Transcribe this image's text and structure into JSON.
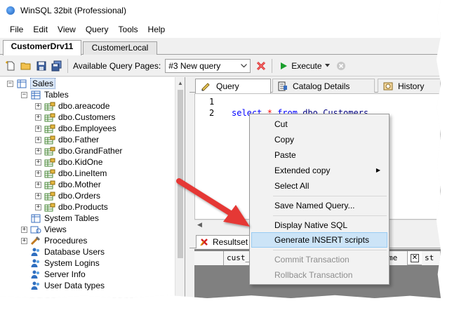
{
  "window": {
    "title": "WinSQL 32bit (Professional)"
  },
  "menu": [
    "File",
    "Edit",
    "View",
    "Query",
    "Tools",
    "Help"
  ],
  "connection_tabs": [
    "CustomerDrv11",
    "CustomerLocal"
  ],
  "toolbar": {
    "pages_label": "Available Query Pages:",
    "selected_page": "#3 New query",
    "execute_label": "Execute"
  },
  "tree": {
    "root": "Sales",
    "tables_label": "Tables",
    "tables": [
      "dbo.areacode",
      "dbo.Customers",
      "dbo.Employees",
      "dbo.Father",
      "dbo.GrandFather",
      "dbo.KidOne",
      "dbo.LineItem",
      "dbo.Mother",
      "dbo.Orders",
      "dbo.Products"
    ],
    "other_nodes": [
      "System Tables",
      "Views",
      "Procedures",
      "Database Users",
      "System Logins",
      "Server Info",
      "User Data types"
    ]
  },
  "query_tabs": [
    "Query",
    "Catalog Details",
    "History"
  ],
  "editor": {
    "line_numbers": [
      "1",
      "2"
    ],
    "tokens": {
      "kw1": "select",
      "op": "*",
      "kw2": "from",
      "table": "dbo.Customers"
    }
  },
  "results": {
    "tab_label": "Resultset #",
    "columns": [
      "cust_",
      "me",
      "st"
    ]
  },
  "context_menu": {
    "items": [
      "Cut",
      "Copy",
      "Paste",
      "Extended copy",
      "Select All",
      "Save Named Query...",
      "Display Native SQL",
      "Generate INSERT scripts",
      "Commit Transaction",
      "Rollback Transaction"
    ]
  },
  "colors": {
    "keyword": "#0000ff",
    "operator": "#ff0000",
    "highlight": "#cce4f7",
    "arrow": "#e53935"
  }
}
